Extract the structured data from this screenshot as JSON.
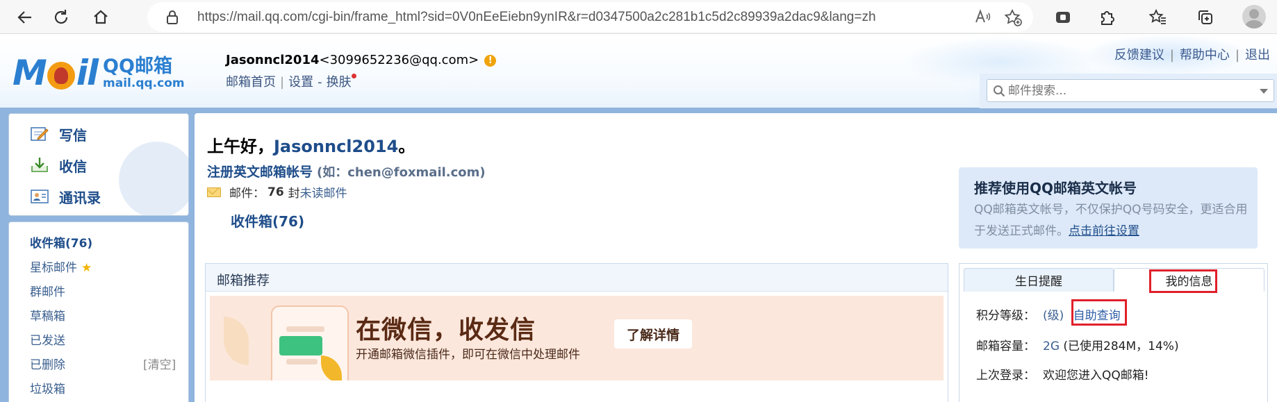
{
  "browser": {
    "url": "https://mail.qq.com/cgi-bin/frame_html?sid=0V0nEeEiebn9ynIR&r=d0347500a2c281b1c5d2c89939a2dac9&lang=zh"
  },
  "header": {
    "logo_word": "MAIL",
    "logo_cn": "QQ邮箱",
    "logo_en": "mail.qq.com",
    "nickname": "Jasonncl2014",
    "email": "<3099652236@qq.com>",
    "warn_glyph": "!",
    "links": {
      "home": "邮箱首页",
      "settings": "设置",
      "dash": "-",
      "skin": "换肤"
    },
    "right_links": {
      "feedback": "反馈建议",
      "help": "帮助中心",
      "logout": "退出"
    },
    "search_placeholder": "邮件搜索..."
  },
  "sidebar": {
    "compose": "写信",
    "receive": "收信",
    "contacts": "通讯录",
    "folders": {
      "inbox": "收件箱(76)",
      "starred": "星标邮件",
      "group": "群邮件",
      "drafts": "草稿箱",
      "sent": "已发送",
      "deleted": "已删除",
      "deleted_clear": "[清空]",
      "spam": "垃圾箱"
    }
  },
  "main": {
    "greeting_prefix": "上午好，",
    "greeting_name": "Jasonncl2014",
    "greeting_suffix": "。",
    "register_link": "注册英文邮箱帐号",
    "register_example": "(如：chen@foxmail.com)",
    "mail_label": "邮件：",
    "mail_count": "76",
    "mail_unit": "封",
    "mail_unread": "未读邮件",
    "inbox_link": "收件箱(76)"
  },
  "promo": {
    "title": "推荐使用QQ邮箱英文帐号",
    "desc": "QQ邮箱英文帐号，不仅保护QQ号码安全，更适合用于发送正式邮件。",
    "link": "点击前往设置"
  },
  "recommend": {
    "header": "邮箱推荐",
    "banner_title": "在微信，收发信",
    "banner_sub": "开通邮箱微信插件，即可在微信中处理邮件",
    "banner_button": "了解详情"
  },
  "info": {
    "tab_birthday": "生日提醒",
    "tab_myinfo": "我的信息",
    "level_label": "积分等级：",
    "level_value": "(级)",
    "self_query": "自助查询",
    "capacity_label": "邮箱容量：",
    "capacity_value": "2G",
    "capacity_used": "(已使用284M，14%)",
    "last_login_label": "上次登录：",
    "last_login_value": "欢迎您进入QQ邮箱!"
  },
  "colors": {
    "brand_blue": "#1e4d8a",
    "frame_blue": "#8fb4dd",
    "highlight_red": "#e0202a"
  }
}
